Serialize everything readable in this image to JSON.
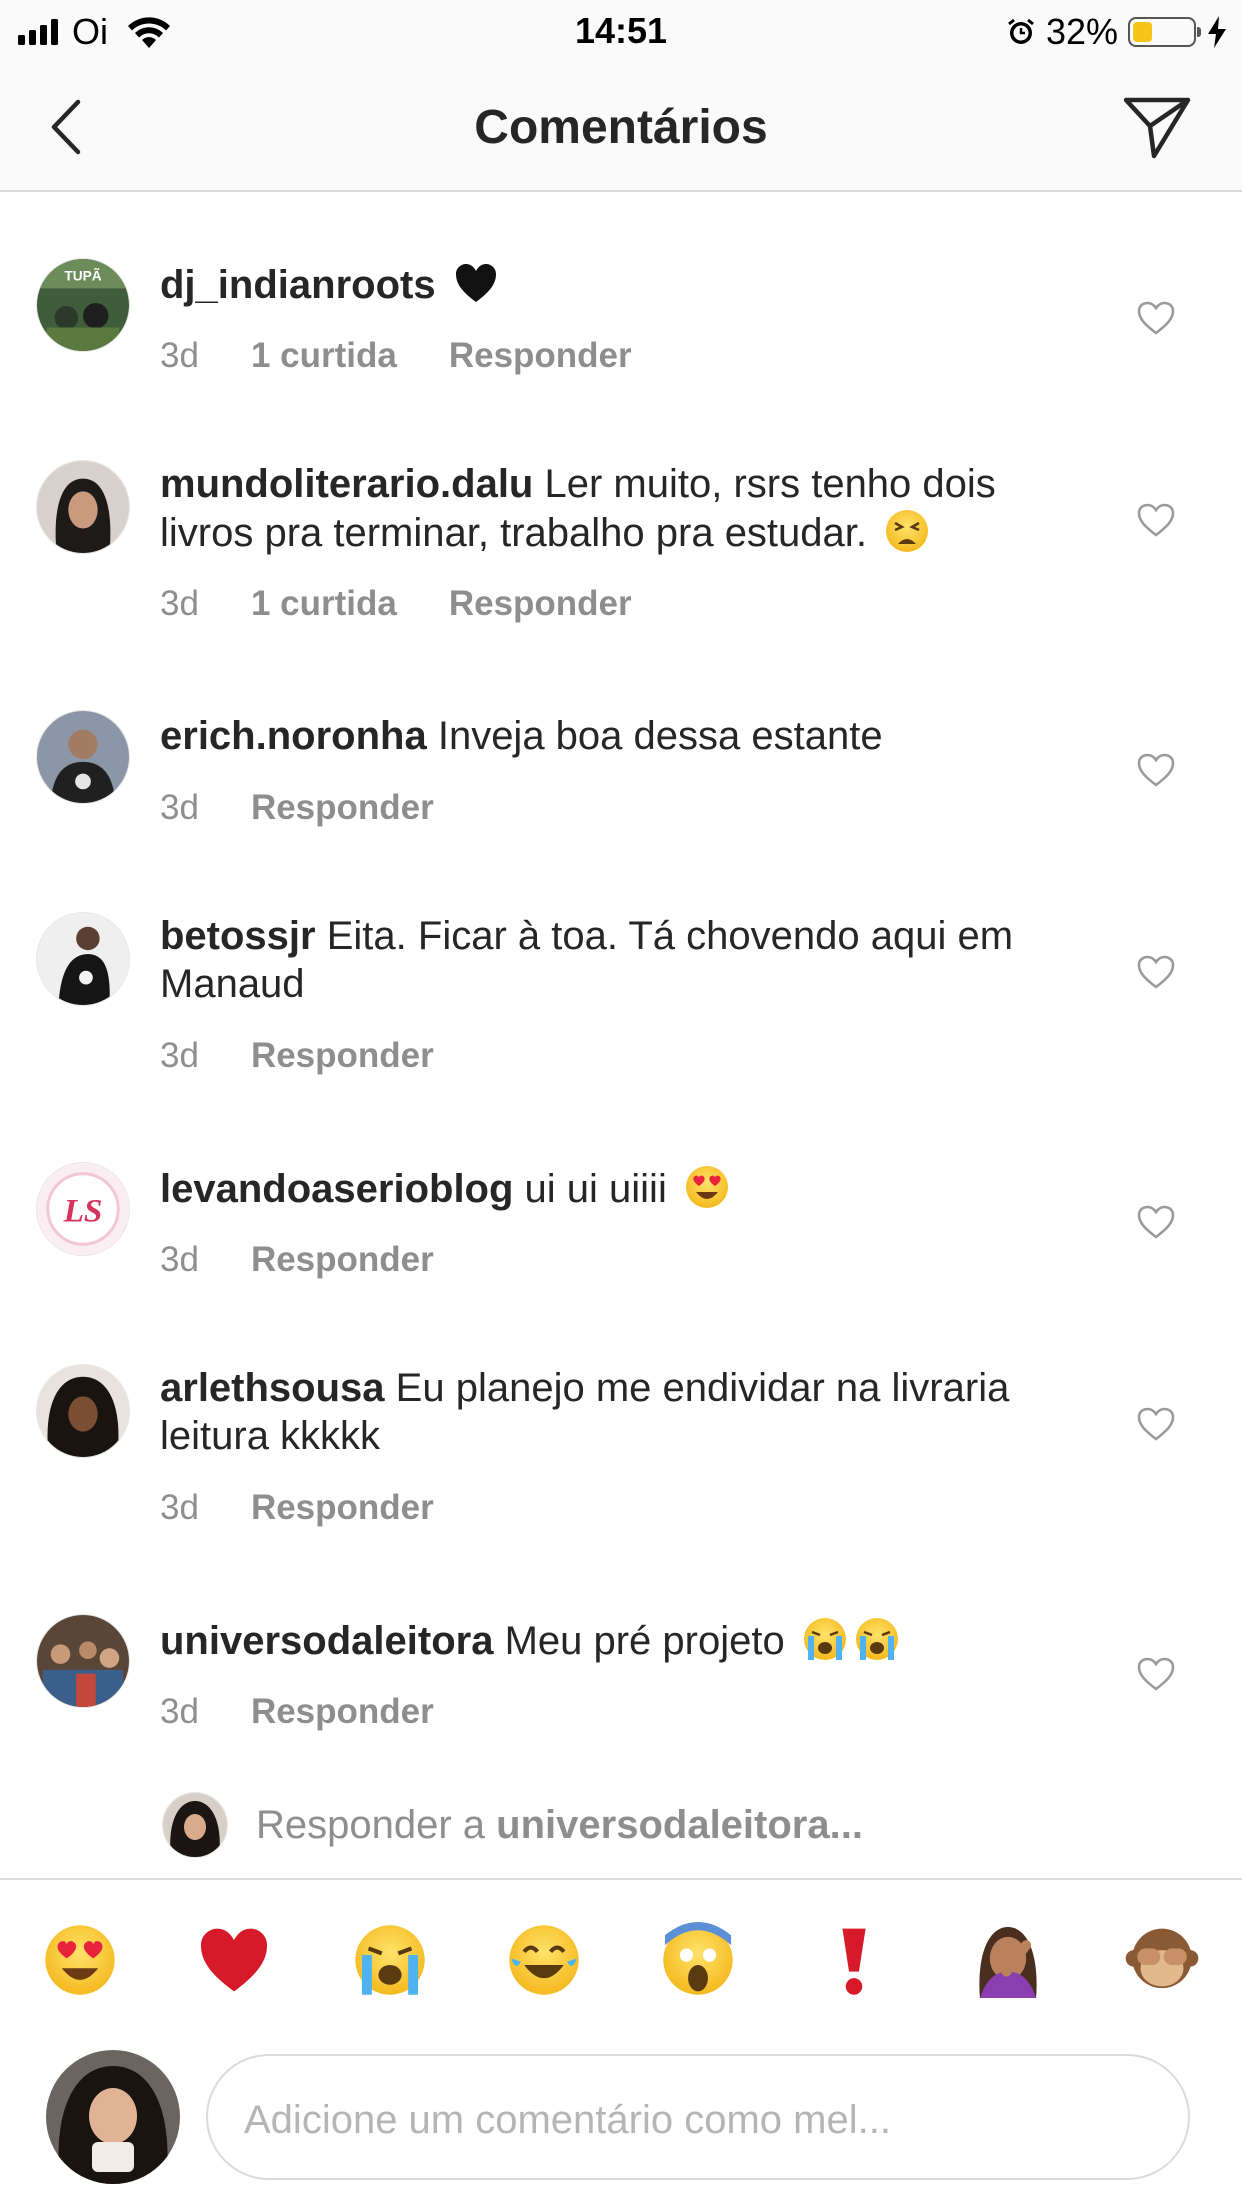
{
  "status_bar": {
    "carrier": "Oi",
    "time": "14:51",
    "battery_percent": "32%",
    "battery_level": 0.32
  },
  "header": {
    "title": "Comentários"
  },
  "comments": [
    {
      "username": "dj_indianroots",
      "text": "",
      "emoji": "black-heart",
      "time": "3d",
      "likes": "1 curtida",
      "reply": "Responder"
    },
    {
      "username": "mundoliterario.dalu",
      "text": "Ler muito, rsrs tenho dois livros pra terminar, trabalho pra estudar.",
      "emoji": "tired-face",
      "time": "3d",
      "likes": "1 curtida",
      "reply": "Responder"
    },
    {
      "username": "erich.noronha",
      "text": "Inveja boa dessa estante",
      "time": "3d",
      "reply": "Responder"
    },
    {
      "username": "betossjr",
      "text": "Eita. Ficar à toa. Tá chovendo aqui em Manaud",
      "time": "3d",
      "reply": "Responder"
    },
    {
      "username": "levandoaserioblog",
      "text": "ui ui uiiii",
      "emoji": "heart-eyes",
      "time": "3d",
      "reply": "Responder"
    },
    {
      "username": "arlethsousa",
      "text": "Eu planejo me endividar na livraria leitura kkkkk",
      "time": "3d",
      "reply": "Responder"
    },
    {
      "username": "universodaleitora",
      "text": "Meu pré projeto",
      "emoji": "crying-face x2",
      "time": "3d",
      "reply": "Responder"
    }
  ],
  "reply_bar": {
    "prefix": "Responder a",
    "target": "universodaleitora..."
  },
  "emoji_bar": [
    "heart-eyes",
    "red-heart",
    "loudly-crying",
    "tears-of-joy",
    "screaming-face",
    "heavy-exclamation",
    "facepalm",
    "see-no-evil-monkey"
  ],
  "composer": {
    "placeholder": "Adicione um comentário como mel..."
  },
  "colors": {
    "text": "#262626",
    "secondary": "#8e8e8e",
    "border": "#dbdbdb",
    "bar_bg": "#fafafa"
  }
}
